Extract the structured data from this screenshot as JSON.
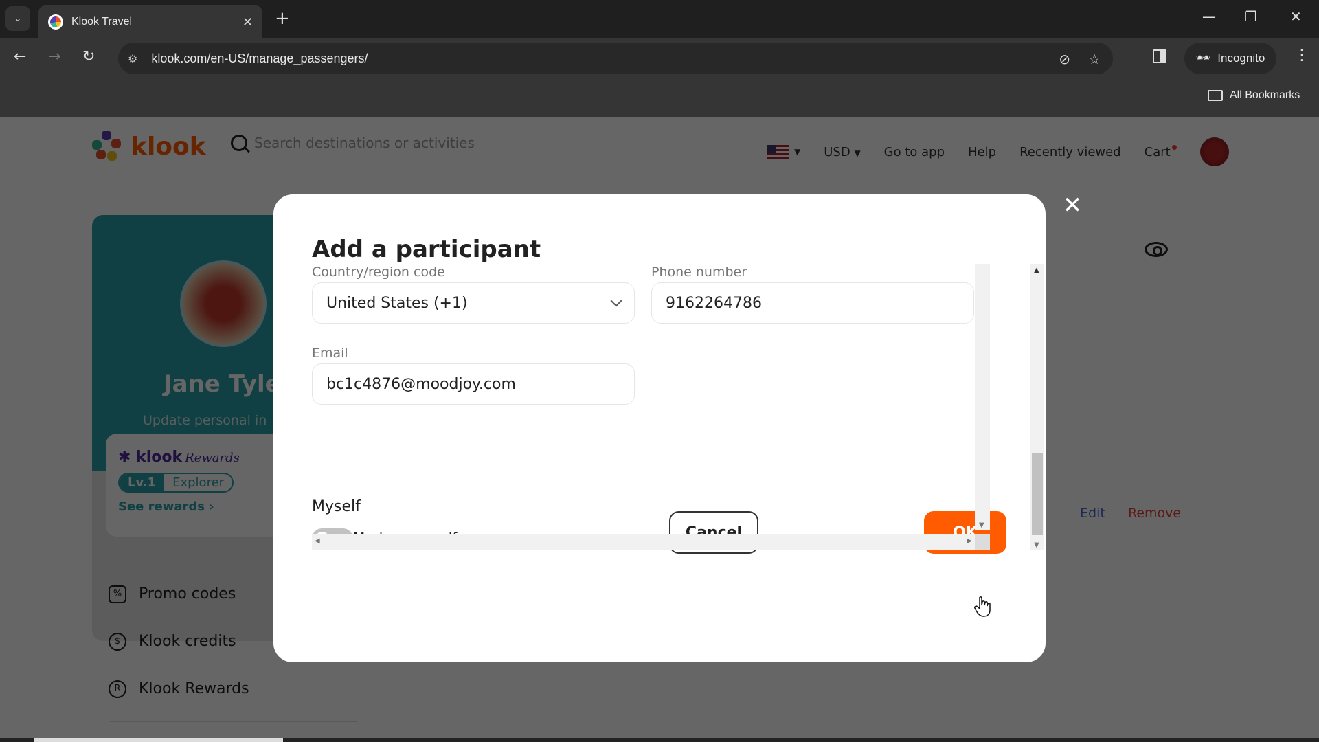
{
  "browser": {
    "tab_title": "Klook Travel",
    "url": "klook.com/en-US/manage_passengers/",
    "incognito_label": "Incognito",
    "bookmarks_label": "All Bookmarks"
  },
  "site_header": {
    "logo_text": "klook",
    "search_placeholder": "Search destinations or activities",
    "currency": "USD",
    "nav": [
      "Go to app",
      "Help",
      "Recently viewed",
      "Cart"
    ]
  },
  "profile": {
    "name": "Jane Tyle",
    "update_link": "Update personal in",
    "rewards_brand": "klook",
    "rewards_script": "Rewards",
    "level": "Lv.1",
    "tier": "Explorer",
    "see_rewards": "See rewards"
  },
  "side_menu": {
    "items": [
      {
        "label": "Promo codes",
        "icon": "promo-code-icon"
      },
      {
        "label": "Klook credits",
        "icon": "money-bag-icon"
      },
      {
        "label": "Klook Rewards",
        "icon": "rewards-icon"
      }
    ]
  },
  "participant_card": {
    "edit_label": "Edit",
    "remove_label": "Remove"
  },
  "modal": {
    "title": "Add a participant",
    "country_label": "Country/region code",
    "country_value": "United States (+1)",
    "phone_label": "Phone number",
    "phone_value": "9162264786",
    "email_label": "Email",
    "email_value": "bc1c4876@moodjoy.com",
    "myself_section": "Myself",
    "mark_myself_label": "Mark as myself",
    "mark_myself_on": false,
    "cancel_label": "Cancel",
    "ok_label": "OK"
  },
  "colors": {
    "brand_orange": "#ff5b00",
    "teal": "#2aa0a8",
    "edit_blue": "#4a68d8",
    "remove_red": "#e0413a"
  }
}
